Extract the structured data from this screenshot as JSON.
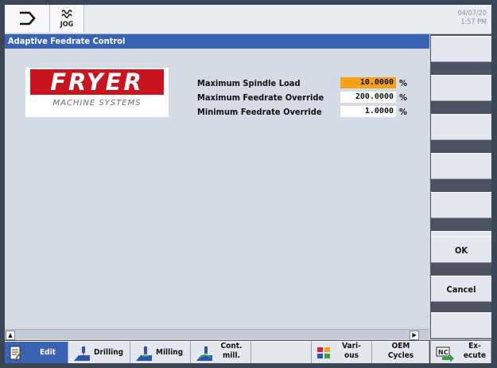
{
  "header": {
    "mode_label": "JOG",
    "date": "04/07/20",
    "time": "1:57 PM"
  },
  "window": {
    "title": "Adaptive Feedrate Control"
  },
  "logo": {
    "name": "FRYER",
    "subtitle": "MACHINE SYSTEMS",
    "brand_color": "#c8141e"
  },
  "params": [
    {
      "label": "Maximum Spindle Load",
      "value": "10.0000",
      "unit": "%",
      "highlight": true
    },
    {
      "label": "Maximum Feedrate Override",
      "value": "200.0000",
      "unit": "%",
      "highlight": false
    },
    {
      "label": "Minimum Feedrate Override",
      "value": "1.0000",
      "unit": "%",
      "highlight": false
    }
  ],
  "vertical_softkeys": [
    "",
    "",
    "",
    "",
    "",
    "",
    "OK",
    "Cancel",
    ""
  ],
  "horizontal_softkeys": {
    "edit": "Edit",
    "drilling": "Drilling",
    "milling": "Milling",
    "cont_mill_1": "Cont.",
    "cont_mill_2": "mill.",
    "various_1": "Vari-",
    "various_2": "ous",
    "oem_1": "OEM",
    "oem_2": "Cycles",
    "execute_1": "Ex-",
    "execute_2": "ecute"
  },
  "colors": {
    "accent": "#3a63b4",
    "highlight": "#f7a219"
  }
}
